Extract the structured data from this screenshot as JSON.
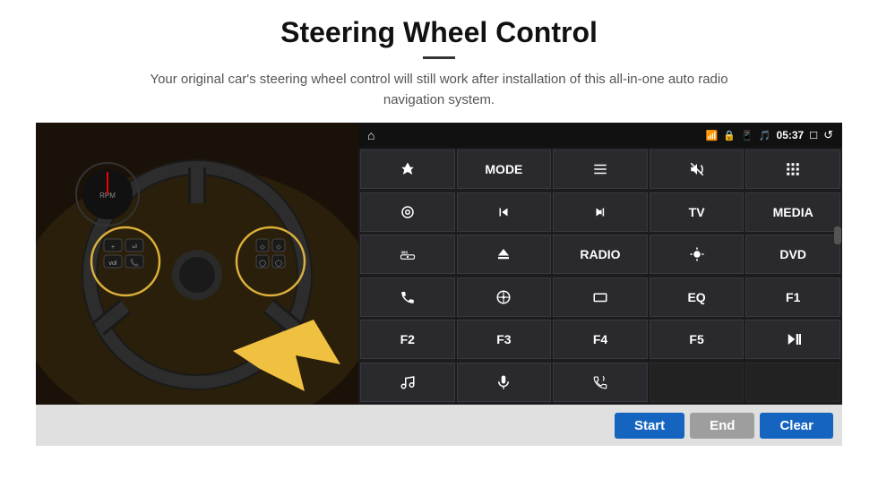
{
  "page": {
    "title": "Steering Wheel Control",
    "subtitle": "Your original car's steering wheel control will still work after installation of this all-in-one auto radio navigation system.",
    "divider_color": "#333"
  },
  "status_bar": {
    "home_icon": "⌂",
    "time": "05:37",
    "wifi_icon": "wifi",
    "lock_icon": "lock",
    "sim_icon": "sim",
    "bt_icon": "bt",
    "screen_icon": "screen",
    "back_icon": "back"
  },
  "action_bar": {
    "start_label": "Start",
    "end_label": "End",
    "clear_label": "Clear"
  },
  "grid_rows": [
    [
      {
        "type": "icon",
        "icon": "nav",
        "label": ""
      },
      {
        "type": "text",
        "label": "MODE"
      },
      {
        "type": "icon",
        "icon": "list"
      },
      {
        "type": "icon",
        "icon": "mute"
      },
      {
        "type": "icon",
        "icon": "grid"
      }
    ],
    [
      {
        "type": "icon",
        "icon": "settings-ring"
      },
      {
        "type": "icon",
        "icon": "prev"
      },
      {
        "type": "icon",
        "icon": "next"
      },
      {
        "type": "text",
        "label": "TV"
      },
      {
        "type": "text",
        "label": "MEDIA"
      }
    ],
    [
      {
        "type": "icon",
        "icon": "360cam"
      },
      {
        "type": "icon",
        "icon": "eject"
      },
      {
        "type": "text",
        "label": "RADIO"
      },
      {
        "type": "icon",
        "icon": "brightness"
      },
      {
        "type": "text",
        "label": "DVD"
      }
    ],
    [
      {
        "type": "icon",
        "icon": "phone"
      },
      {
        "type": "icon",
        "icon": "navi"
      },
      {
        "type": "icon",
        "icon": "rectangle"
      },
      {
        "type": "text",
        "label": "EQ"
      },
      {
        "type": "text",
        "label": "F1"
      }
    ],
    [
      {
        "type": "text",
        "label": "F2"
      },
      {
        "type": "text",
        "label": "F3"
      },
      {
        "type": "text",
        "label": "F4"
      },
      {
        "type": "text",
        "label": "F5"
      },
      {
        "type": "icon",
        "icon": "playpause"
      }
    ],
    [
      {
        "type": "icon",
        "icon": "music"
      },
      {
        "type": "icon",
        "icon": "mic"
      },
      {
        "type": "icon",
        "icon": "phone-vol"
      },
      {
        "type": "empty"
      },
      {
        "type": "empty"
      }
    ]
  ]
}
